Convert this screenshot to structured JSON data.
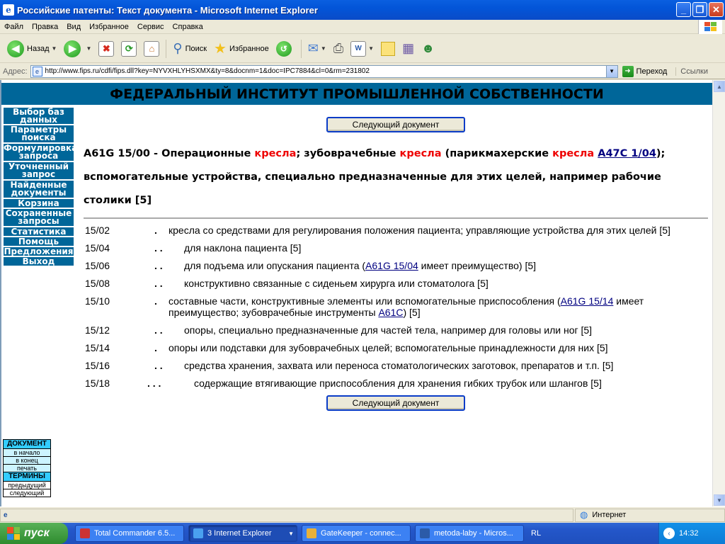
{
  "window": {
    "title": "Российские патенты: Текст документа - Microsoft Internet Explorer",
    "icon": "ie-icon"
  },
  "menu": [
    "Файл",
    "Правка",
    "Вид",
    "Избранное",
    "Сервис",
    "Справка"
  ],
  "toolbar": {
    "back": "Назад",
    "search": "Поиск",
    "favorites": "Избранное"
  },
  "address": {
    "label": "Адрес:",
    "url": "http://www.fips.ru/cdfi/fips.dll?key=NYVXHLYHSXMX&ty=8&docnm=1&doc=IPC7884&cl=0&rm=231802",
    "go": "Переход",
    "links": "Ссылки"
  },
  "page": {
    "header": "ФЕДЕРАЛЬНЫЙ ИНСТИТУТ ПРОМЫШЛЕННОЙ СОБСТВЕННОСТИ",
    "nav": [
      "Выбор баз данных",
      "Параметры поиска",
      "Формулировка запроса",
      "Уточненный запрос",
      "Найденные документы",
      "Корзина",
      "Сохраненные запросы",
      "Статистика",
      "Помощь",
      "Предложения",
      "Выход"
    ],
    "docbox": {
      "doc_title": "ДОКУМЕНТ",
      "to_start": "в начало",
      "to_end": "в конец",
      "print": "печать",
      "terms_title": "ТЕРМИНЫ",
      "prev": "предыдущий",
      "next": "следующий"
    },
    "next_button": "Следующий документ",
    "heading": {
      "code": "A61G 15/00 - Операционные ",
      "kw1": "кресла",
      "part2": "; зубоврачебные ",
      "kw2": "кресла",
      "part3": " (парикмахерские ",
      "kw3": "кресла",
      "space": " ",
      "link": "A47C 1/04",
      "part4": ");",
      "line2": "вспомогательные устройства, специально предназначенные для этих целей, например рабочие столики [5]"
    },
    "entries": [
      {
        "code": "15/02",
        "dots": ".",
        "text": "кресла со средствами для регулирования положения пациента; управляющие устройства для этих целей [5]"
      },
      {
        "code": "15/04",
        "dots": ". .",
        "text": "для наклона пациента [5]"
      },
      {
        "code": "15/06",
        "dots": ". .",
        "pre": "для подъема или опускания пациента (",
        "link": "A61G 15/04",
        "post": " имеет преимущество) [5]"
      },
      {
        "code": "15/08",
        "dots": ". .",
        "text": "конструктивно связанные с сиденьем хирурга или стоматолога [5]"
      },
      {
        "code": "15/10",
        "dots": ".",
        "pre": "составные части, конструктивные элементы или вспомогательные приспособления (",
        "link": "A61G 15/14",
        "mid": " имеет преимущество; зубоврачебные инструменты ",
        "link2": "A61C",
        "post": ") [5]"
      },
      {
        "code": "15/12",
        "dots": ". .",
        "text": "опоры, специально предназначенные для частей тела, например для головы или ног [5]"
      },
      {
        "code": "15/14",
        "dots": ".",
        "text": "опоры или подставки для зубоврачебных целей; вспомогательные принадлежности для них [5]"
      },
      {
        "code": "15/16",
        "dots": ". .",
        "text": "средства хранения, захвата или переноса стоматологических заготовок, препаратов и т.п. [5]"
      },
      {
        "code": "15/18",
        "dots": ". . .",
        "text": "содержащие втягивающие приспособления для хранения гибких трубок или шлангов [5]"
      }
    ]
  },
  "status": {
    "zone": "Интернет"
  },
  "taskbar": {
    "start": "пуск",
    "tasks": [
      "Total Commander 6.5...",
      "3 Internet Explorer",
      "GateKeeper - connec...",
      "metoda-laby - Micros..."
    ],
    "lang": "RL",
    "clock": "14:32"
  }
}
